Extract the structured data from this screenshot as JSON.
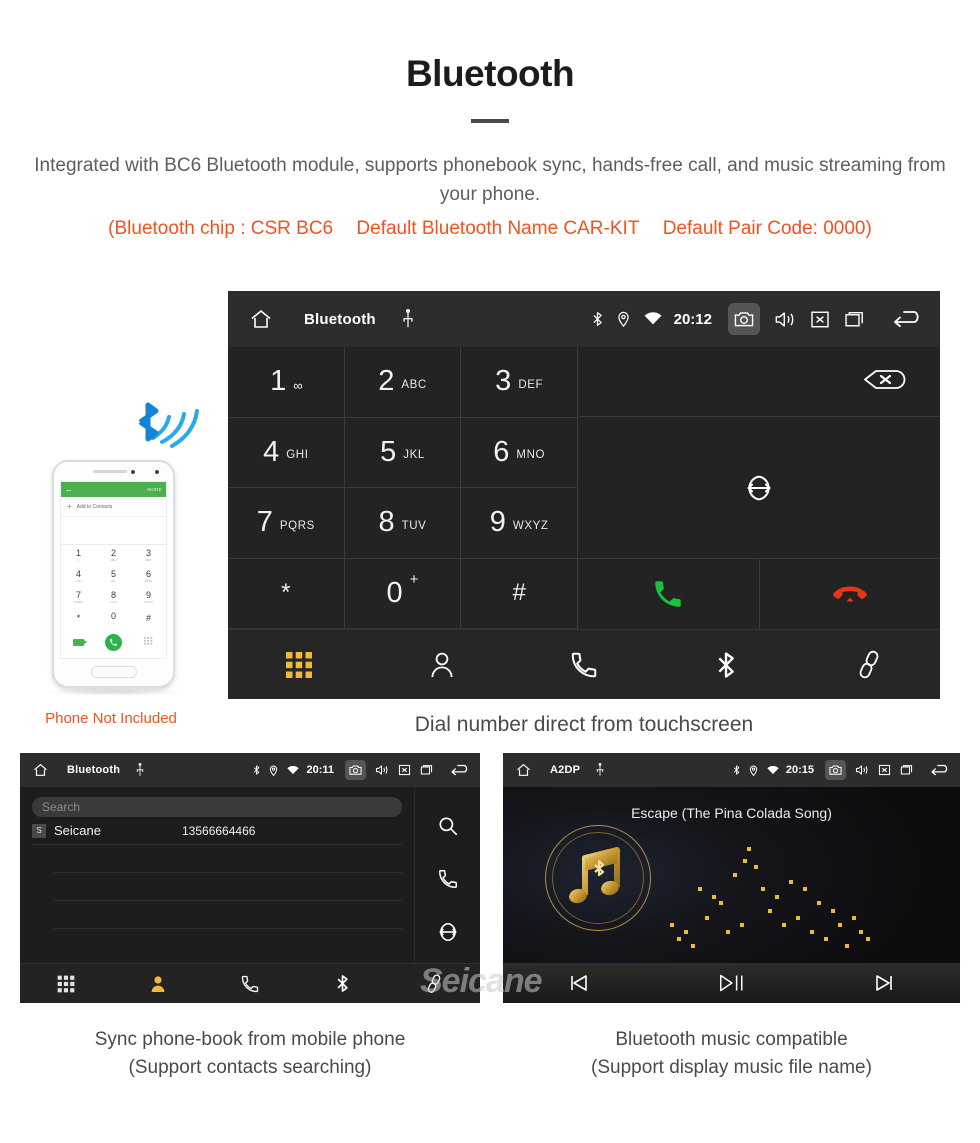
{
  "header": {
    "title": "Bluetooth",
    "intro": "Integrated with BC6 Bluetooth module, supports phonebook sync, hands-free call, and music streaming from your phone.",
    "spec_open": "(Bluetooth chip : CSR BC6",
    "spec_name": "Default Bluetooth Name CAR-KIT",
    "spec_pair": "Default Pair Code: 0000)",
    "accent_color": "#f4511e"
  },
  "dialer": {
    "statusbar": {
      "title": "Bluetooth",
      "clock": "20:12",
      "icons": [
        "home-icon",
        "usb-icon",
        "bluetooth-icon",
        "location-icon",
        "wifi-icon",
        "camera-icon",
        "volume-icon",
        "close-icon",
        "recents-icon",
        "back-icon"
      ]
    },
    "keys": [
      {
        "num": "1",
        "sub": "∞",
        "kind": "voicemail"
      },
      {
        "num": "2",
        "sub": "ABC",
        "kind": "letters"
      },
      {
        "num": "3",
        "sub": "DEF",
        "kind": "letters"
      },
      {
        "num": "4",
        "sub": "GHI",
        "kind": "letters"
      },
      {
        "num": "5",
        "sub": "JKL",
        "kind": "letters"
      },
      {
        "num": "6",
        "sub": "MNO",
        "kind": "letters"
      },
      {
        "num": "7",
        "sub": "PQRS",
        "kind": "letters"
      },
      {
        "num": "8",
        "sub": "TUV",
        "kind": "letters"
      },
      {
        "num": "9",
        "sub": "WXYZ",
        "kind": "letters"
      },
      {
        "num": "*",
        "sub": "",
        "kind": "symbol"
      },
      {
        "num": "0",
        "sub": "+",
        "kind": "plus"
      },
      {
        "num": "#",
        "sub": "",
        "kind": "symbol"
      }
    ],
    "number_input": "",
    "actions": {
      "backspace": "backspace-icon",
      "sync": "sync-icon",
      "call": "call-icon",
      "hangup": "hangup-icon",
      "call_color": "#18c23a",
      "hangup_color": "#e8341a"
    },
    "tabs": [
      {
        "name": "keypad",
        "icon": "keypad-icon",
        "active": true
      },
      {
        "name": "contacts",
        "icon": "person-icon",
        "active": false
      },
      {
        "name": "call-log",
        "icon": "phone-handset-icon",
        "active": false
      },
      {
        "name": "bluetooth",
        "icon": "bluetooth-icon",
        "active": false
      },
      {
        "name": "link",
        "icon": "link-icon",
        "active": false
      }
    ],
    "active_tab_color": "#f0b93b",
    "caption": "Dial number direct from touchscreen"
  },
  "phone_illustration": {
    "bar_back": "←",
    "bar_more": "MORE",
    "add_to_contacts": "Add to Contacts",
    "keys": [
      {
        "n": "1",
        "s": "∞"
      },
      {
        "n": "2",
        "s": "ABC"
      },
      {
        "n": "3",
        "s": "DEF"
      },
      {
        "n": "4",
        "s": "GHI"
      },
      {
        "n": "5",
        "s": "JKL"
      },
      {
        "n": "6",
        "s": "MNO"
      },
      {
        "n": "7",
        "s": "PQRS"
      },
      {
        "n": "8",
        "s": "TUV"
      },
      {
        "n": "9",
        "s": "WXYZ"
      },
      {
        "n": "*",
        "s": ""
      },
      {
        "n": "0",
        "s": "+"
      },
      {
        "n": "#",
        "s": ""
      }
    ],
    "not_included": "Phone Not Included",
    "accent_green": "#4caf50"
  },
  "contacts_panel": {
    "statusbar": {
      "title": "Bluetooth",
      "clock": "20:11"
    },
    "search_placeholder": "Search",
    "rows": [
      {
        "badge": "S",
        "name": "Seicane",
        "number": "13566664466"
      },
      {
        "badge": "",
        "name": "",
        "number": ""
      },
      {
        "badge": "",
        "name": "",
        "number": ""
      },
      {
        "badge": "",
        "name": "",
        "number": ""
      }
    ],
    "side_actions": [
      "search-icon",
      "phone-handset-icon",
      "sync-icon"
    ],
    "tabs": [
      {
        "name": "keypad",
        "icon": "keypad-icon",
        "active": false
      },
      {
        "name": "contacts",
        "icon": "person-icon",
        "active": true
      },
      {
        "name": "call-log",
        "icon": "phone-handset-icon",
        "active": false
      },
      {
        "name": "bluetooth",
        "icon": "bluetooth-icon",
        "active": false
      },
      {
        "name": "link",
        "icon": "link-icon",
        "active": false
      }
    ],
    "caption_line1": "Sync phone-book from mobile phone",
    "caption_line2": "(Support contacts searching)"
  },
  "music_panel": {
    "statusbar": {
      "title": "A2DP",
      "clock": "20:15"
    },
    "song_title": "Escape (The Pina Colada Song)",
    "album_icon": "music-note-bluetooth-icon",
    "controls": [
      {
        "name": "previous",
        "icon": "previous-track-icon"
      },
      {
        "name": "play-pause",
        "icon": "play-pause-icon"
      },
      {
        "name": "next",
        "icon": "next-track-icon"
      }
    ],
    "gold_color": "#c8992f",
    "caption_line1": "Bluetooth music compatible",
    "caption_line2": "(Support display music file name)"
  },
  "watermark": "Seicane"
}
